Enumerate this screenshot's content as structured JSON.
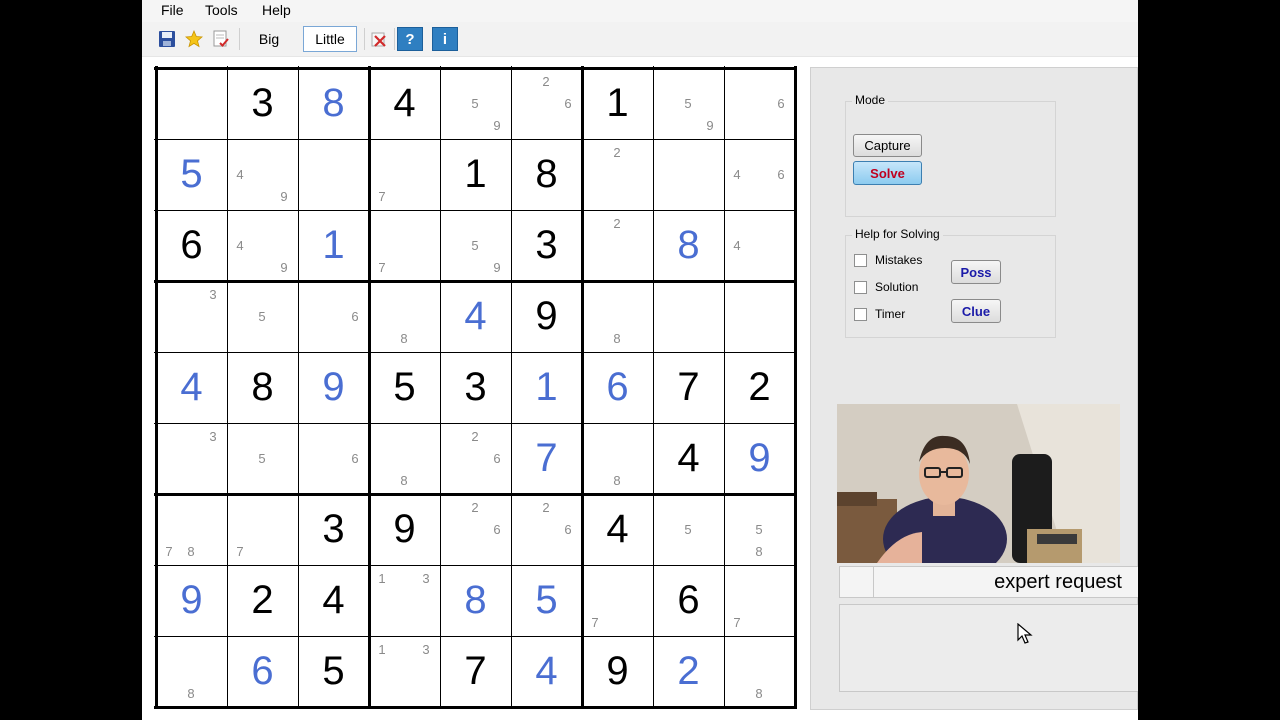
{
  "menu": {
    "file": "File",
    "tools": "Tools",
    "help": "Help"
  },
  "toolbar": {
    "big_label": "Big",
    "little_label": "Little",
    "help_label": "?",
    "info_label": "i",
    "icons": [
      "save-icon",
      "star-icon",
      "edit-check-icon",
      "clear-icon"
    ]
  },
  "board": {
    "cells": [
      [
        {
          "c": []
        },
        {
          "g": "3"
        },
        {
          "e": "8"
        },
        {
          "g": "4"
        },
        {
          "c": [
            "5",
            "9"
          ]
        },
        {
          "c": [
            "2",
            "6"
          ]
        },
        {
          "g": "1"
        },
        {
          "c": [
            "5",
            "9"
          ]
        },
        {
          "c": [
            "6"
          ]
        }
      ],
      [
        {
          "e": "5"
        },
        {
          "c": [
            "4",
            "9"
          ]
        },
        {
          "c": []
        },
        {
          "c": [
            "7"
          ]
        },
        {
          "g": "1"
        },
        {
          "g": "8"
        },
        {
          "c": [
            "2"
          ]
        },
        {
          "c": []
        },
        {
          "c": [
            "4",
            "6"
          ]
        }
      ],
      [
        {
          "g": "6"
        },
        {
          "c": [
            "4",
            "9"
          ]
        },
        {
          "e": "1"
        },
        {
          "c": [
            "7"
          ]
        },
        {
          "c": [
            "5",
            "9"
          ]
        },
        {
          "g": "3"
        },
        {
          "c": [
            "2"
          ]
        },
        {
          "e": "8"
        },
        {
          "c": [
            "4"
          ]
        }
      ],
      [
        {
          "c": [
            "3"
          ]
        },
        {
          "c": [
            "5"
          ]
        },
        {
          "c": [
            "6"
          ]
        },
        {
          "c": [
            "8"
          ]
        },
        {
          "e": "4"
        },
        {
          "g": "9"
        },
        {
          "c": [
            "8"
          ]
        },
        {
          "c": []
        },
        {
          "c": []
        }
      ],
      [
        {
          "e": "4"
        },
        {
          "g": "8"
        },
        {
          "e": "9"
        },
        {
          "g": "5"
        },
        {
          "g": "3"
        },
        {
          "e": "1"
        },
        {
          "e": "6"
        },
        {
          "g": "7"
        },
        {
          "g": "2"
        }
      ],
      [
        {
          "c": [
            "3"
          ]
        },
        {
          "c": [
            "5"
          ]
        },
        {
          "c": [
            "6"
          ]
        },
        {
          "c": [
            "8"
          ]
        },
        {
          "c": [
            "2",
            "6"
          ]
        },
        {
          "e": "7"
        },
        {
          "c": [
            "8"
          ]
        },
        {
          "g": "4"
        },
        {
          "e": "9"
        }
      ],
      [
        {
          "c": [
            "7",
            "8"
          ]
        },
        {
          "c": [
            "7"
          ]
        },
        {
          "g": "3"
        },
        {
          "g": "9"
        },
        {
          "c": [
            "2",
            "6"
          ]
        },
        {
          "c": [
            "2",
            "6"
          ]
        },
        {
          "g": "4"
        },
        {
          "c": [
            "5"
          ]
        },
        {
          "c": [
            "5",
            "8"
          ]
        }
      ],
      [
        {
          "e": "9"
        },
        {
          "g": "2"
        },
        {
          "g": "4"
        },
        {
          "c": [
            "1",
            "3"
          ]
        },
        {
          "e": "8"
        },
        {
          "e": "5"
        },
        {
          "c": [
            "7"
          ]
        },
        {
          "g": "6"
        },
        {
          "c": [
            "7"
          ]
        }
      ],
      [
        {
          "c": [
            "8"
          ]
        },
        {
          "e": "6"
        },
        {
          "g": "5"
        },
        {
          "c": [
            "1",
            "3"
          ]
        },
        {
          "g": "7"
        },
        {
          "e": "4"
        },
        {
          "g": "9"
        },
        {
          "e": "2"
        },
        {
          "c": [
            "8"
          ]
        }
      ]
    ]
  },
  "panel": {
    "mode_title": "Mode",
    "capture_label": "Capture",
    "solve_label": "Solve",
    "help_title": "Help for Solving",
    "mistakes_label": "Mistakes",
    "solution_label": "Solution",
    "timer_label": "Timer",
    "poss_label": "Poss",
    "clue_label": "Clue",
    "status_text": "expert request"
  },
  "colors": {
    "entered_digit": "#4a6ed2",
    "given_digit": "#000000",
    "candidate": "#8a8a8a",
    "solve_text": "#c0001f",
    "toolbar_blue": "#2f7fc1"
  }
}
